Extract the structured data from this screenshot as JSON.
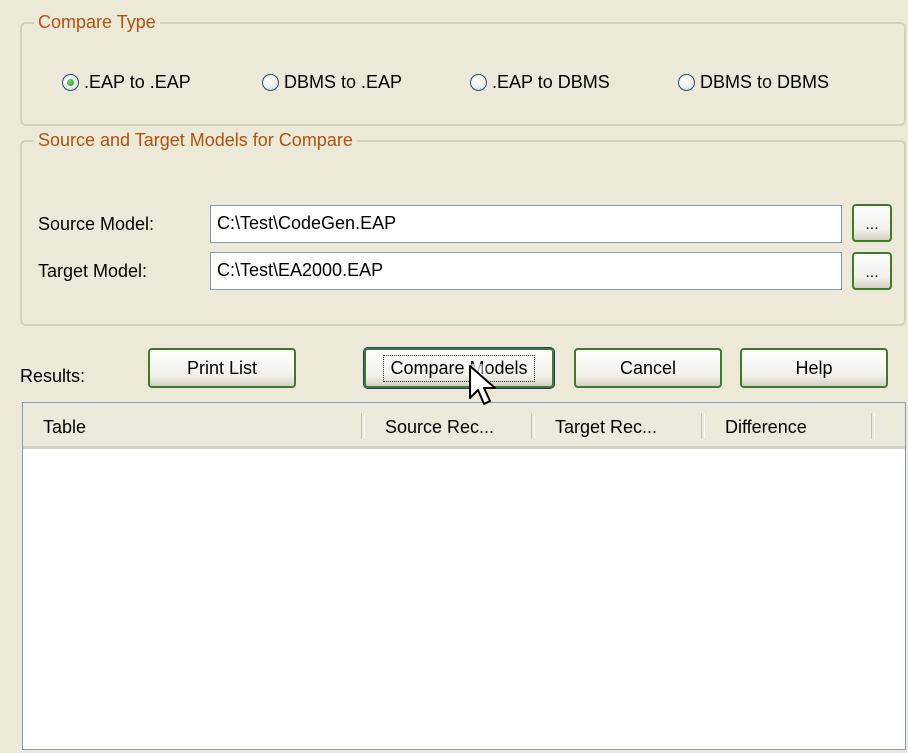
{
  "compare_type": {
    "legend": "Compare Type",
    "options": [
      {
        "label": ".EAP to .EAP",
        "checked": true
      },
      {
        "label": "DBMS to .EAP",
        "checked": false
      },
      {
        "label": ".EAP to DBMS",
        "checked": false
      },
      {
        "label": "DBMS to DBMS",
        "checked": false
      }
    ]
  },
  "models": {
    "legend": "Source and Target Models for Compare",
    "source_label": "Source Model:",
    "source_value": "C:\\Test\\CodeGen.EAP",
    "target_label": "Target Model:",
    "target_value": "C:\\Test\\EA2000.EAP",
    "browse_label": "..."
  },
  "results": {
    "label": "Results:",
    "buttons": {
      "print": "Print List",
      "compare": "Compare Models",
      "cancel": "Cancel",
      "help": "Help"
    },
    "columns": [
      "Table",
      "Source Rec...",
      "Target Rec...",
      "Difference"
    ],
    "rows": []
  },
  "colors": {
    "background": "#ECE9D8",
    "legend_text": "#B0520E",
    "button_border": "#3F7A2A",
    "radio_dot": "#21A121"
  }
}
